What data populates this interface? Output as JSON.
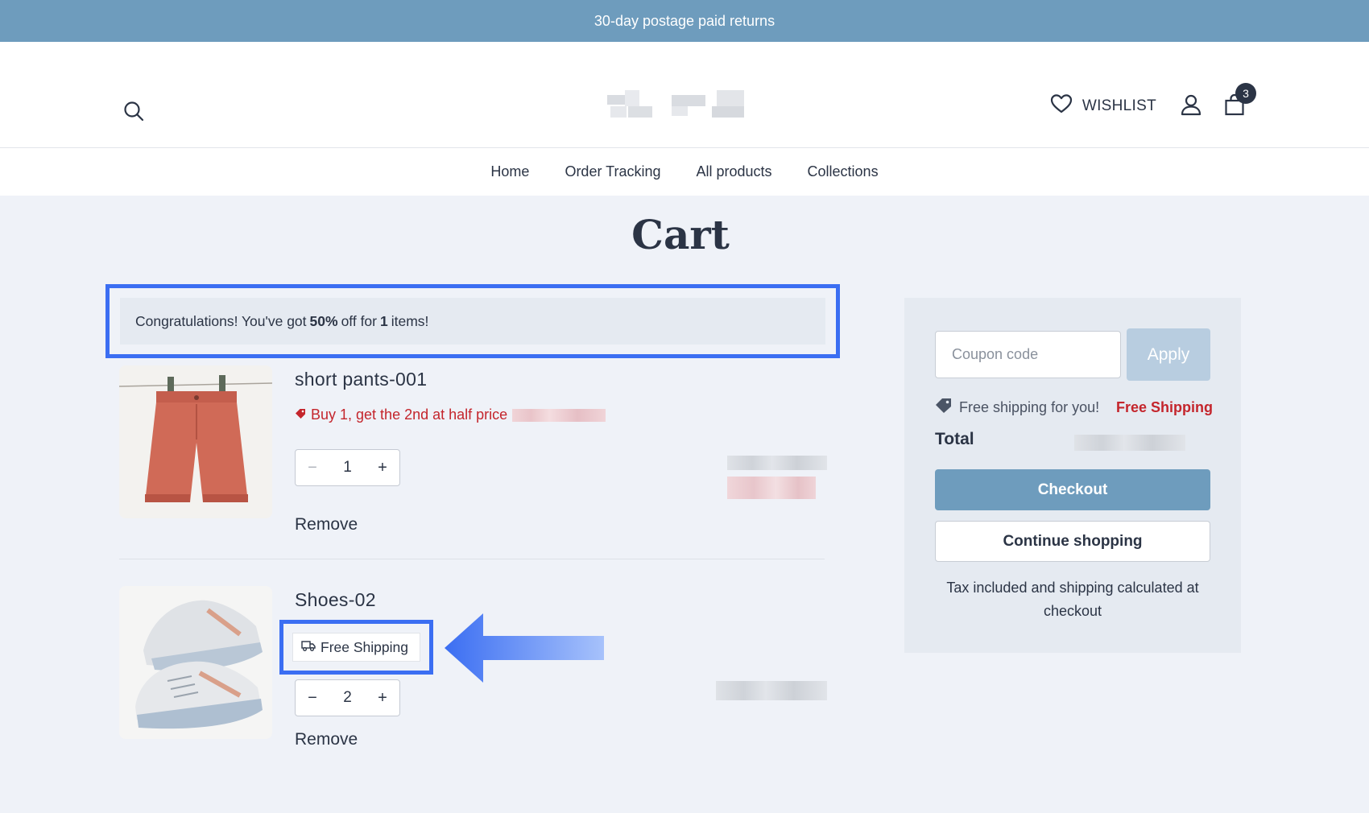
{
  "announcement": {
    "text": "30-day postage paid returns"
  },
  "header": {
    "wishlist_label": "WISHLIST",
    "cart_count": "3",
    "icons": [
      "search-icon",
      "heart-icon",
      "user-icon",
      "shopping-bag-icon"
    ]
  },
  "nav": {
    "items": [
      {
        "label": "Home"
      },
      {
        "label": "Order Tracking"
      },
      {
        "label": "All products"
      },
      {
        "label": "Collections"
      }
    ]
  },
  "page": {
    "title": "Cart"
  },
  "discount_banner": {
    "prefix": "Congratulations! You've got",
    "percent": "50%",
    "middle": "off for",
    "count": "1",
    "suffix": "items!"
  },
  "cart": {
    "items": [
      {
        "name": "short pants-001",
        "promo": "Buy 1, get the 2nd at half price",
        "quantity": "1",
        "minus": "−",
        "plus": "+",
        "remove_label": "Remove"
      },
      {
        "name": "Shoes-02",
        "badge": "Free Shipping",
        "quantity": "2",
        "minus": "−",
        "plus": "+",
        "remove_label": "Remove"
      }
    ]
  },
  "summary": {
    "coupon_placeholder": "Coupon code",
    "apply_label": "Apply",
    "free_shipping_text": "Free shipping for you!",
    "free_shipping_label": "Free Shipping",
    "total_label": "Total",
    "checkout_label": "Checkout",
    "continue_label": "Continue shopping",
    "tax_note": "Tax included and shipping calculated at checkout"
  },
  "colors": {
    "brand": "#6e9cbd",
    "accent_red": "#c4252c",
    "highlight_blue": "#3b6ef2",
    "text": "#2b3445"
  }
}
